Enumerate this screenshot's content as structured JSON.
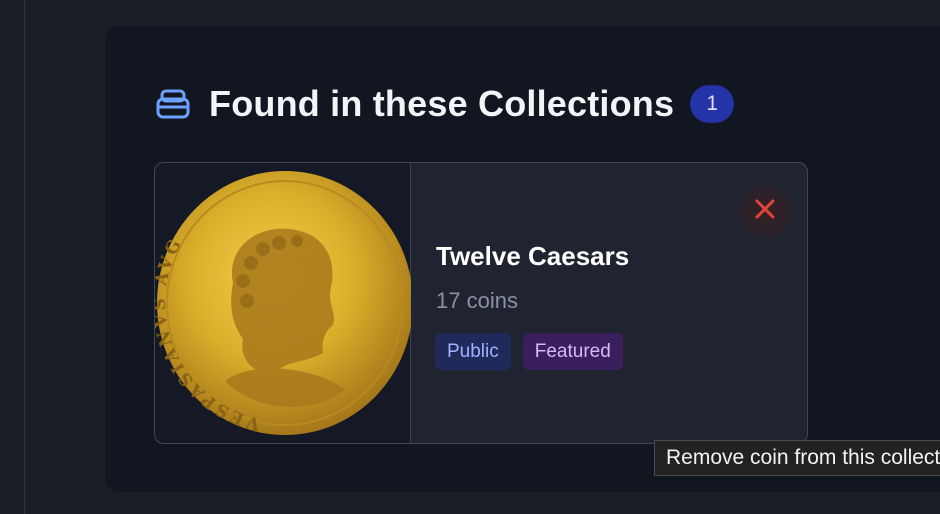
{
  "section": {
    "title": "Found in these Collections",
    "count": "1",
    "icon": "stack-icon"
  },
  "collections": [
    {
      "name": "Twelve Caesars",
      "coin_count": "17 coins",
      "tags": [
        "Public",
        "Featured"
      ],
      "coin_legend": "VESPASIANVS AVG",
      "remove_icon": "close-icon"
    }
  ],
  "tooltip": "Remove coin from this collection",
  "colors": {
    "page_bg": "#1a1e27",
    "panel_bg": "#121621",
    "card_bg": "#1f2430",
    "accent_icon": "#6ea0ff",
    "badge_bg": "#2433a6",
    "remove_red": "#e0453a",
    "gold": "#d9ad2a"
  }
}
